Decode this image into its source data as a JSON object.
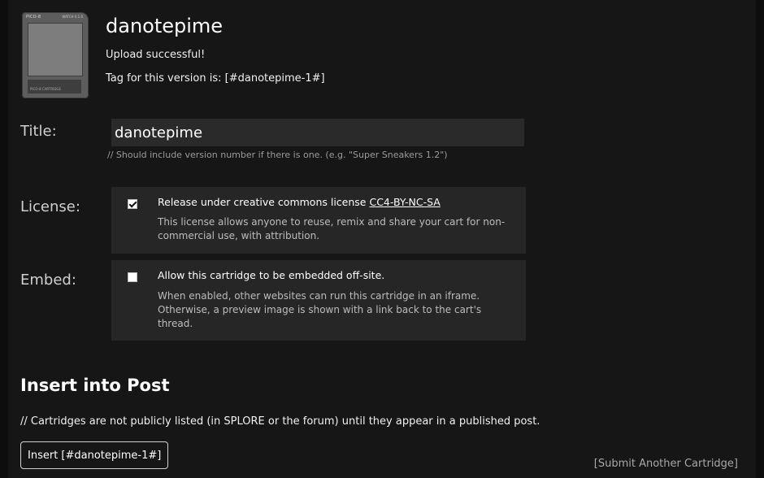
{
  "cartridge": {
    "thumb_top_left": "PICO-8",
    "thumb_top_right": "WATCH 0.1.0",
    "thumb_bottom": "PICO-8 CARTRIDGE",
    "name": "danotepime",
    "upload_message": "Upload successful!",
    "tag_message": "Tag for this version is: [#danotepime-1#]"
  },
  "title_field": {
    "label": "Title:",
    "value": "danotepime",
    "hint": "// Should include version number if there is one. (e.g. \"Super Sneakers 1.2\")"
  },
  "license": {
    "label": "License:",
    "checked": true,
    "option_text": "Release under creative commons license ",
    "link_text": "CC4-BY-NC-SA",
    "description": "This license allows anyone to reuse, remix and share your cart for non-commercial use, with attribution."
  },
  "embed": {
    "label": "Embed:",
    "checked": false,
    "option_text": "Allow this cartridge to be embedded off-site.",
    "description": "When enabled, other websites can run this cartridge in an iframe. Otherwise, a preview image is shown with a link back to the cart's thread."
  },
  "insert": {
    "heading": "Insert into Post",
    "note": "// Cartridges are not publicly listed (in SPLORE or the forum) until they appear in a published post.",
    "button_label": "Insert [#danotepime-1#]"
  },
  "submit_another": "[Submit Another Cartridge]",
  "colors": {
    "background": "#0d0d0d",
    "panel": "#161616",
    "option_box": "#262626",
    "input": "#2a2a2a"
  }
}
